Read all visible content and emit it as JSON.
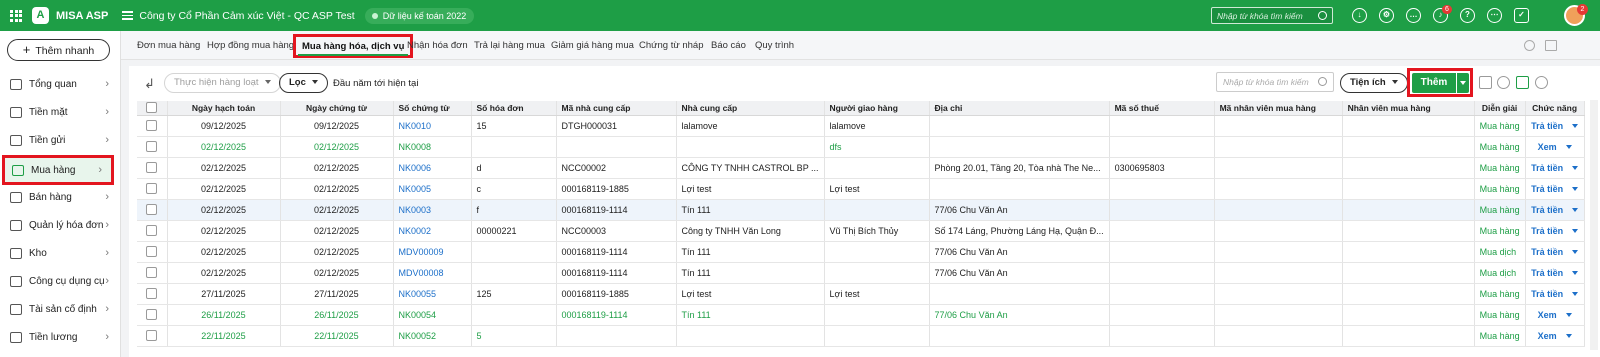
{
  "topbar": {
    "brand": "MISA ASP",
    "company": "Công ty Cổ Phần Cảm xúc Việt - QC ASP Test",
    "data_badge": "Dữ liệu kế toán 2022",
    "search_placeholder": "Nhập từ khóa tìm kiếm",
    "notification_count": "6",
    "avatar_badge": "2",
    "icons": [
      "download-icon",
      "settings-icon",
      "chat-icon",
      "bell-icon",
      "help-icon",
      "more-icon",
      "gift-icon"
    ]
  },
  "sidebar": {
    "add_button": "Thêm nhanh",
    "items": [
      {
        "label": "Tổng quan",
        "icon": "dashboard-icon"
      },
      {
        "label": "Tiền mặt",
        "icon": "cash-icon"
      },
      {
        "label": "Tiền gửi",
        "icon": "bank-icon"
      },
      {
        "label": "Mua hàng",
        "icon": "purchase-bag-icon",
        "active": true
      },
      {
        "label": "Bán hàng",
        "icon": "cart-icon"
      },
      {
        "label": "Quản lý hóa đơn",
        "icon": "invoice-icon"
      },
      {
        "label": "Kho",
        "icon": "warehouse-icon"
      },
      {
        "label": "Công cụ dụng cụ",
        "icon": "tools-icon"
      },
      {
        "label": "Tài sản cố định",
        "icon": "asset-icon"
      },
      {
        "label": "Tiền lương",
        "icon": "salary-icon"
      }
    ]
  },
  "tabs": [
    "Đơn mua hàng",
    "Hợp đồng mua hàng",
    "Mua hàng hóa, dịch vụ",
    "Nhận hóa đơn",
    "Trả lại hàng mua",
    "Giảm giá hàng mua",
    "Chứng từ nháp",
    "Báo cáo",
    "Quy trình"
  ],
  "toolbar": {
    "bulk_action": "Thực hiện hàng loạt",
    "filter": "Lọc",
    "period": "Đầu năm tới hiện tại",
    "search_placeholder": "Nhập từ khóa tìm kiếm",
    "utilities": "Tiện ích",
    "add": "Thêm"
  },
  "table": {
    "columns": [
      "Ngày hạch toán",
      "Ngày chứng từ",
      "Số chứng từ",
      "Số hóa đơn",
      "Mã nhà cung cấp",
      "Nhà cung cấp",
      "Người giao hàng",
      "Địa chỉ",
      "Mã số thuế",
      "Mã nhân viên mua hàng",
      "Nhân viên mua hàng",
      "Diễn giải",
      "Chức năng"
    ],
    "rows": [
      {
        "posting": "09/12/2025",
        "doc_date": "09/12/2025",
        "doc_no": "NK0010",
        "invoice": "15",
        "supplier_code": "DTGH000031",
        "supplier": "lalamove",
        "deliverer": "lalamove",
        "address": "",
        "tax": "",
        "emp_code": "",
        "emp": "",
        "desc": "Mua hàng",
        "action": "Trả tiền",
        "status": "normal"
      },
      {
        "posting": "02/12/2025",
        "doc_date": "02/12/2025",
        "doc_no": "NK0008",
        "invoice": "",
        "supplier_code": "",
        "supplier": "",
        "deliverer": "dfs",
        "address": "",
        "tax": "",
        "emp_code": "",
        "emp": "",
        "desc": "Mua hàng",
        "action": "Xem",
        "status": "green"
      },
      {
        "posting": "02/12/2025",
        "doc_date": "02/12/2025",
        "doc_no": "NK0006",
        "invoice": "d",
        "supplier_code": "NCC00002",
        "supplier": "CÔNG TY TNHH CASTROL BP ...",
        "deliverer": "",
        "address": "Phòng 20.01, Tầng 20, Tòa nhà The Ne...",
        "tax": "0300695803",
        "emp_code": "",
        "emp": "",
        "desc": "Mua hàng",
        "action": "Trả tiền",
        "status": "normal"
      },
      {
        "posting": "02/12/2025",
        "doc_date": "02/12/2025",
        "doc_no": "NK0005",
        "invoice": "c",
        "supplier_code": "000168119-1885",
        "supplier": "Lợi test",
        "deliverer": "Lợi test",
        "address": "",
        "tax": "",
        "emp_code": "",
        "emp": "",
        "desc": "Mua hàng",
        "action": "Trả tiền",
        "status": "normal"
      },
      {
        "posting": "02/12/2025",
        "doc_date": "02/12/2025",
        "doc_no": "NK0003",
        "invoice": "f",
        "supplier_code": "000168119-1114",
        "supplier": "Tín 111",
        "deliverer": "",
        "address": "77/06 Chu Văn An",
        "tax": "",
        "emp_code": "",
        "emp": "",
        "desc": "Mua hàng",
        "action": "Trả tiền",
        "status": "highlight"
      },
      {
        "posting": "02/12/2025",
        "doc_date": "02/12/2025",
        "doc_no": "NK0002",
        "invoice": "00000221",
        "supplier_code": "NCC00003",
        "supplier": "Công ty TNHH Văn Long",
        "deliverer": "Vũ Thị Bích Thủy",
        "address": "Số 174 Láng, Phường Láng Hạ, Quận Đ...",
        "tax": "",
        "emp_code": "",
        "emp": "",
        "desc": "Mua hàng",
        "action": "Trả tiền",
        "status": "normal"
      },
      {
        "posting": "02/12/2025",
        "doc_date": "02/12/2025",
        "doc_no": "MDV00009",
        "invoice": "",
        "supplier_code": "000168119-1114",
        "supplier": "Tín 111",
        "deliverer": "",
        "address": "77/06 Chu Văn An",
        "tax": "",
        "emp_code": "",
        "emp": "",
        "desc": "Mua dịch",
        "action": "Trả tiền",
        "status": "normal"
      },
      {
        "posting": "02/12/2025",
        "doc_date": "02/12/2025",
        "doc_no": "MDV00008",
        "invoice": "",
        "supplier_code": "000168119-1114",
        "supplier": "Tín 111",
        "deliverer": "",
        "address": "77/06 Chu Văn An",
        "tax": "",
        "emp_code": "",
        "emp": "",
        "desc": "Mua dịch",
        "action": "Trả tiền",
        "status": "normal"
      },
      {
        "posting": "27/11/2025",
        "doc_date": "27/11/2025",
        "doc_no": "NK00055",
        "invoice": "125",
        "supplier_code": "000168119-1885",
        "supplier": "Lợi test",
        "deliverer": "Lợi test",
        "address": "",
        "tax": "",
        "emp_code": "",
        "emp": "",
        "desc": "Mua hàng",
        "action": "Trả tiền",
        "status": "normal"
      },
      {
        "posting": "26/11/2025",
        "doc_date": "26/11/2025",
        "doc_no": "NK00054",
        "invoice": "",
        "supplier_code": "000168119-1114",
        "supplier": "Tín 111",
        "deliverer": "",
        "address": "77/06 Chu Văn An",
        "tax": "",
        "emp_code": "",
        "emp": "",
        "desc": "Mua hàng",
        "action": "Xem",
        "status": "green"
      },
      {
        "posting": "22/11/2025",
        "doc_date": "22/11/2025",
        "doc_no": "NK00052",
        "invoice": "5",
        "supplier_code": "",
        "supplier": "",
        "deliverer": "",
        "address": "",
        "tax": "",
        "emp_code": "",
        "emp": "",
        "desc": "Mua hàng",
        "action": "Xem",
        "status": "green"
      }
    ]
  }
}
